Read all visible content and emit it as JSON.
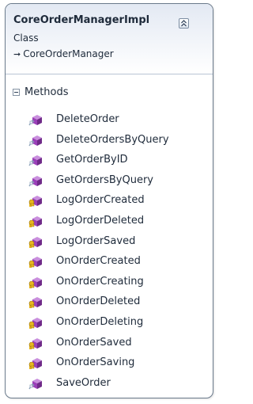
{
  "class_shape": {
    "name": "CoreOrderManagerImpl",
    "stereotype": "Class",
    "base_type": "CoreOrderManager",
    "base_arrow_icon": "inheritance-arrow-icon",
    "collapse_icon": "double-chevron-up-icon"
  },
  "sections": [
    {
      "label": "Methods",
      "expanded": true,
      "methods": [
        {
          "name": "DeleteOrder",
          "access": "public"
        },
        {
          "name": "DeleteOrdersByQuery",
          "access": "public"
        },
        {
          "name": "GetOrderByID",
          "access": "public"
        },
        {
          "name": "GetOrdersByQuery",
          "access": "public"
        },
        {
          "name": "LogOrderCreated",
          "access": "protected"
        },
        {
          "name": "LogOrderDeleted",
          "access": "protected"
        },
        {
          "name": "LogOrderSaved",
          "access": "protected"
        },
        {
          "name": "OnOrderCreated",
          "access": "protected"
        },
        {
          "name": "OnOrderCreating",
          "access": "protected"
        },
        {
          "name": "OnOrderDeleted",
          "access": "protected"
        },
        {
          "name": "OnOrderDeleting",
          "access": "protected"
        },
        {
          "name": "OnOrderSaved",
          "access": "protected"
        },
        {
          "name": "OnOrderSaving",
          "access": "protected"
        },
        {
          "name": "SaveOrder",
          "access": "public"
        }
      ]
    }
  ],
  "colors": {
    "border": "#6b7b8c",
    "header_gradient_top": "#e3e9f3",
    "method_cube": "#9b3fb8",
    "public_overlay": "#8aa0b8",
    "protected_overlay": "#e8b820"
  }
}
